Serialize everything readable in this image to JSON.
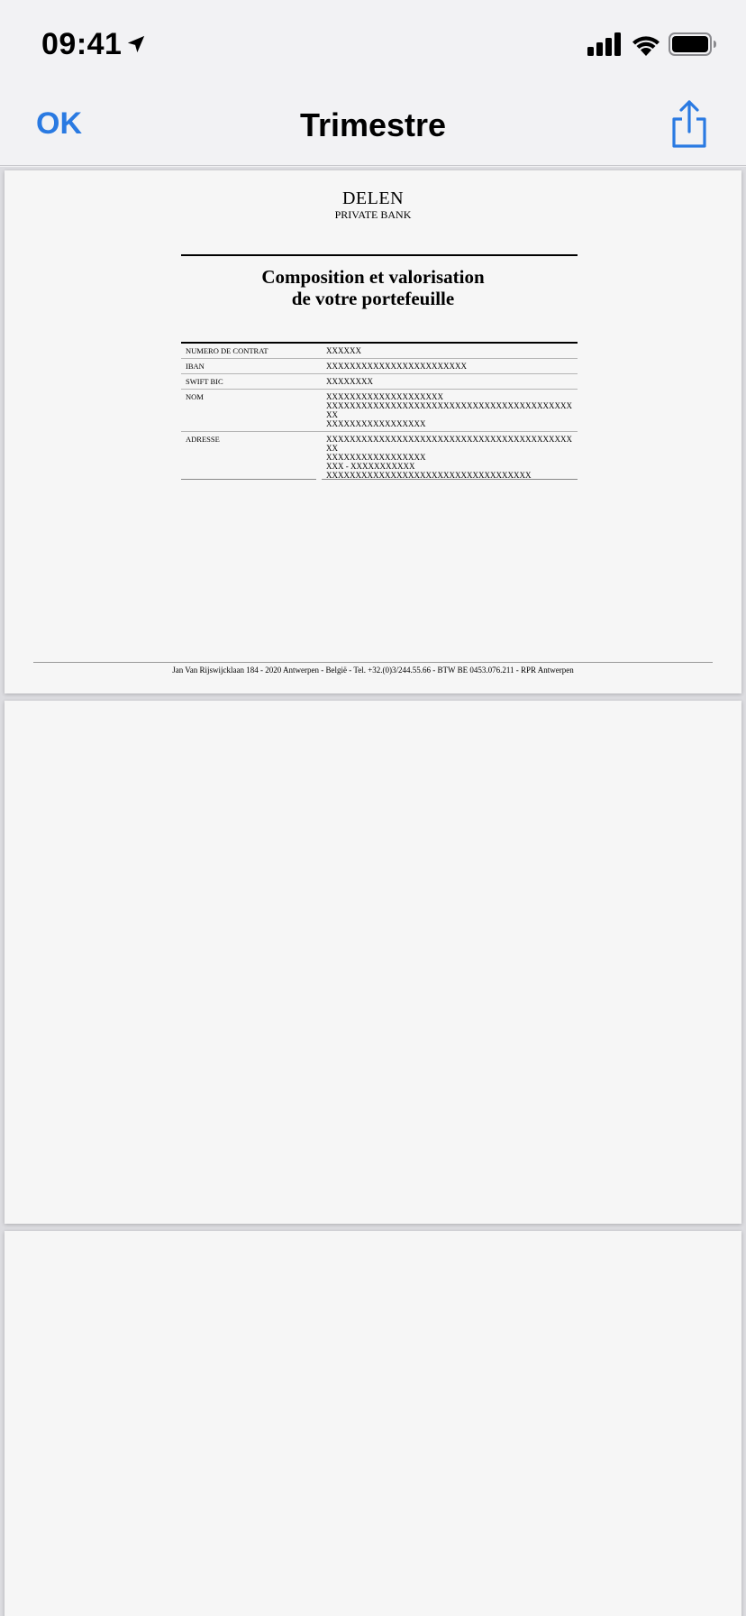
{
  "status_bar": {
    "time": "09:41"
  },
  "nav": {
    "ok_label": "OK",
    "title": "Trimestre"
  },
  "document": {
    "brand": "DELEN",
    "brand_sub": "PRIVATE BANK",
    "title_line1": "Composition et valorisation",
    "title_line2": "de votre portefeuille",
    "rows": [
      {
        "label": "NUMERO DE CONTRAT",
        "value": "XXXXXX"
      },
      {
        "label": "IBAN",
        "value": "XXXXXXXXXXXXXXXXXXXXXXXX"
      },
      {
        "label": "SWIFT BIC",
        "value": "XXXXXXXX"
      },
      {
        "label": "NOM",
        "value": "XXXXXXXXXXXXXXXXXXXX\nXXXXXXXXXXXXXXXXXXXXXXXXXXXXXXXXXXXXXXXXXXXX\nXXXXXXXXXXXXXXXXX"
      },
      {
        "label": "ADRESSE",
        "value": "XXXXXXXXXXXXXXXXXXXXXXXXXXXXXXXXXXXXXXXXXXXX\nXXXXXXXXXXXXXXXXX\nXXX - XXXXXXXXXXX\nXXXXXXXXXXXXXXXXXXXXXXXXXXXXXXXXXXX"
      }
    ],
    "footer": "Jan Van Rijswijcklaan 184 - 2020 Antwerpen - België - Tel. +32.(0)3/244.55.66 - BTW BE 0453.076.211 - RPR Antwerpen"
  },
  "colors": {
    "accent": "#2a7ae2",
    "background": "#f2f2f4",
    "page": "#f6f6f6"
  },
  "icons": {
    "location": "location-arrow-icon",
    "signal": "cellular-signal-icon",
    "wifi": "wifi-icon",
    "battery": "battery-icon",
    "share": "share-icon"
  }
}
